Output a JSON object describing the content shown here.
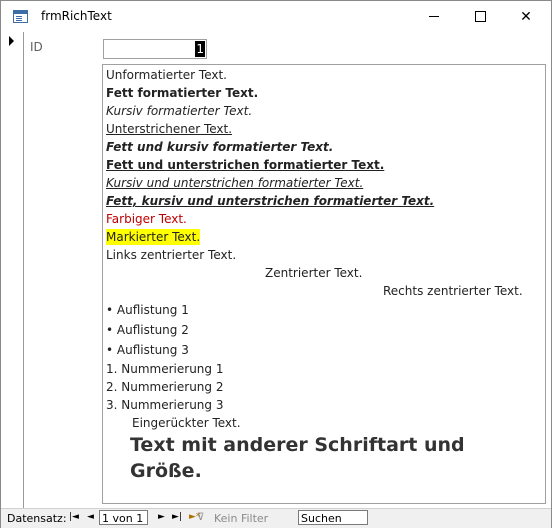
{
  "window": {
    "title": "frmRichText",
    "minimize": "—",
    "maximize": "☐",
    "close": "✕"
  },
  "form": {
    "id_label": "ID",
    "id_value": "1",
    "rich_text": {
      "plain": "Unformatierter Text.",
      "bold": "Fett formatierter Text.",
      "italic": "Kursiv formatierter Text.",
      "underline": "Unterstrichener Text.",
      "bold_italic": "Fett und kursiv formatierter Text.",
      "bold_underline": "Fett und unterstrichen formatierter Text.",
      "italic_underline": "Kursiv und unterstrichen formatierter Text.",
      "bold_italic_underline": "Fett, kursiv und unterstrichen formatierter Text.",
      "colored": "Farbiger Text.",
      "highlighted": "Markierter Text.",
      "left": "Links zentrierter Text.",
      "center": "Zentrierter Text.",
      "right": "Rechts zentrierter Text.",
      "bullets": [
        "Auflistung 1",
        "Auflistung 2",
        "Auflistung 3"
      ],
      "numbered": [
        "1. Nummerierung 1",
        "2. Nummerierung 2",
        "3. Nummerierung 3"
      ],
      "indented": "Eingerückter Text.",
      "different_font_line1": "Text mit anderer Schriftart und",
      "different_font_line2": "Größe."
    }
  },
  "navigation": {
    "label": "Datensatz:",
    "first": "|◄",
    "prev": "◄",
    "record": "1 von 1",
    "next": "►",
    "last": "►|",
    "new": "►*",
    "filter": "Kein Filter",
    "search_placeholder": "Suchen"
  },
  "colors": {
    "text_red": "#c00000",
    "highlight": "#ffff00"
  }
}
